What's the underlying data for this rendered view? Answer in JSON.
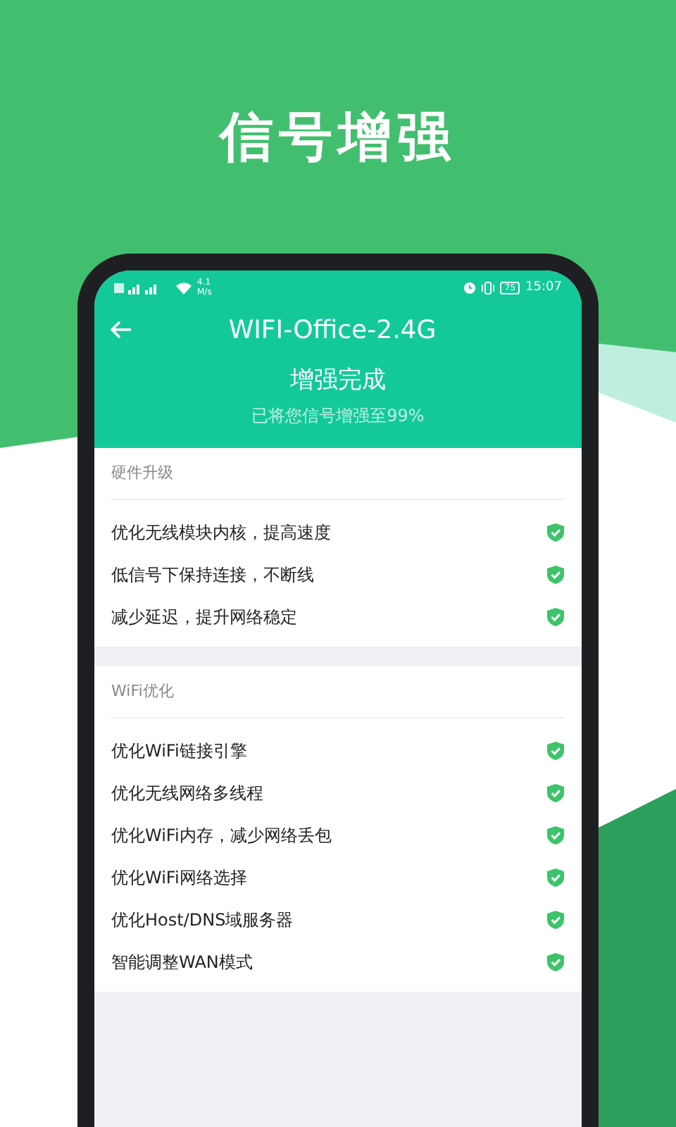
{
  "headline": "信号增强",
  "status_bar": {
    "speed_value": "4.1",
    "speed_unit": "M/s",
    "battery": "75",
    "time": "15:07"
  },
  "header": {
    "title": "WIFI-Office-2.4G",
    "status": "增强完成",
    "subtitle": "已将您信号增强至99%"
  },
  "sections": [
    {
      "title": "硬件升级",
      "items": [
        {
          "label": "优化无线模块内核，提高速度",
          "checked": true
        },
        {
          "label": "低信号下保持连接，不断线",
          "checked": true
        },
        {
          "label": "减少延迟，提升网络稳定",
          "checked": true
        }
      ]
    },
    {
      "title": "WiFi优化",
      "items": [
        {
          "label": "优化WiFi链接引擎",
          "checked": true
        },
        {
          "label": "优化无线网络多线程",
          "checked": true
        },
        {
          "label": "优化WiFi内存，减少网络丢包",
          "checked": true
        },
        {
          "label": "优化WiFi网络选择",
          "checked": true
        },
        {
          "label": "优化Host/DNS域服务器",
          "checked": true
        },
        {
          "label": "智能调整WAN模式",
          "checked": true
        }
      ]
    }
  ]
}
